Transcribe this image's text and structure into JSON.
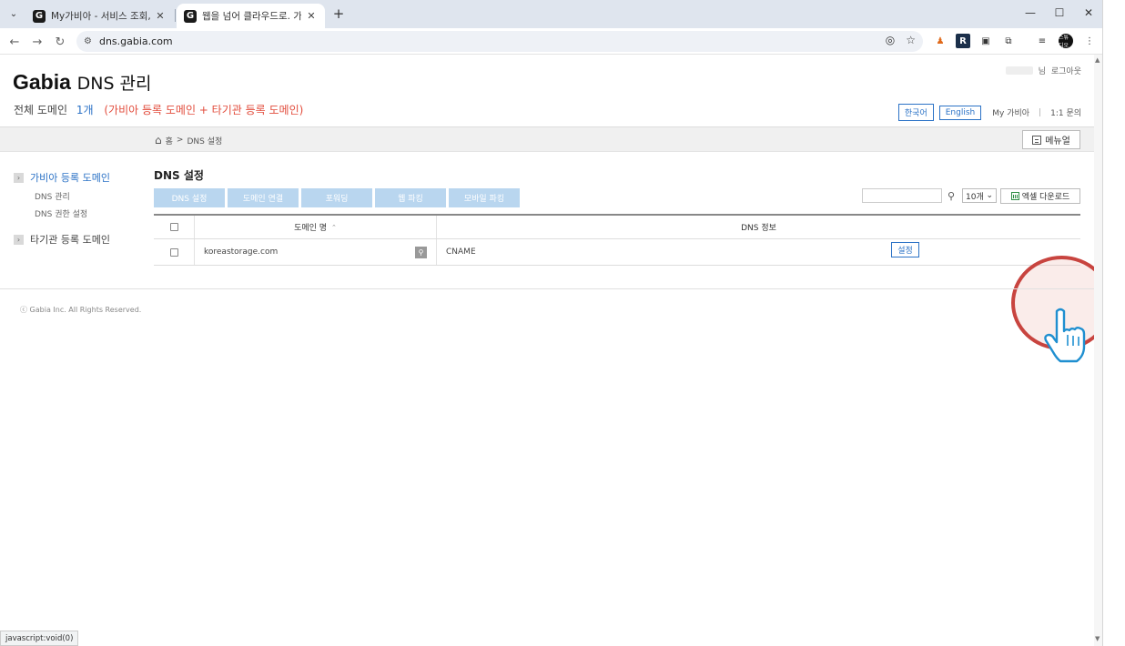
{
  "browser": {
    "tabs": [
      {
        "title": "My가비아 - 서비스 조회, 비용",
        "active": false,
        "favicon": "G"
      },
      {
        "title": "웹을 넘어 클라우드로. 가비아",
        "active": true,
        "favicon": "G"
      }
    ],
    "url": "dns.gabia.com",
    "status_url": "javascript:void(0)",
    "profile_badge": "스튜디오"
  },
  "header": {
    "brand": "Gabia",
    "brand_sub": "DNS 관리",
    "summary_label": "전체 도메인",
    "summary_count": "1개",
    "summary_detail": "(가비아 등록 도메인 + 타기관 등록 도메인)",
    "user_suffix": "님",
    "logout": "로그아웃",
    "lang_ko": "한국어",
    "lang_en": "English",
    "my_gabia": "My 가비아",
    "inquiry": "1:1 문의"
  },
  "breadcrumb": {
    "home": "홈",
    "separator": ">",
    "current": "DNS 설정",
    "menu_open": "메뉴얼"
  },
  "sidebar": {
    "groups": [
      {
        "label": "가비아 등록 도메인",
        "active": true,
        "items": [
          "DNS 관리",
          "DNS 권한 설정"
        ]
      },
      {
        "label": "타기관 등록 도메인",
        "active": false,
        "items": []
      }
    ]
  },
  "main": {
    "title": "DNS 설정",
    "actions": [
      "DNS 설정",
      "도메인 연결",
      "포워딩",
      "웹 파킹",
      "모바일 파킹"
    ],
    "search_placeholder": "",
    "per_page": "10개",
    "excel_download": "엑셀 다운로드",
    "table": {
      "columns": [
        "도메인 명",
        "DNS 정보"
      ],
      "rows": [
        {
          "domain": "koreastorage.com",
          "dns": "CNAME",
          "action": "설정"
        }
      ]
    }
  },
  "footer": {
    "copyright": "ⓒ Gabia Inc. All Rights Reserved."
  },
  "colors": {
    "accent": "#2b72c6",
    "red_text": "#e24c3c",
    "action_button": "#b9d6ef",
    "highlight_ring": "#c8443f"
  }
}
